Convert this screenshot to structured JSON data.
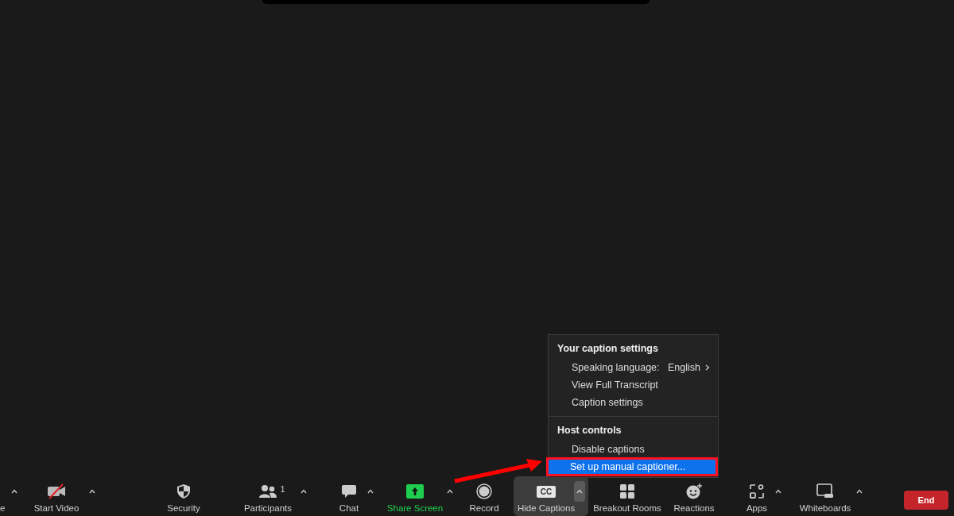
{
  "toolbar": {
    "items": [
      {
        "kind": "mic",
        "label": "e",
        "menu_caret": true,
        "selected": false
      },
      {
        "kind": "video",
        "label": "Start Video",
        "menu_caret": true,
        "selected": false
      },
      {
        "kind": "security",
        "label": "Security",
        "menu_caret": false,
        "selected": false
      },
      {
        "kind": "participants",
        "label": "Participants",
        "count": "1",
        "menu_caret": true,
        "selected": false
      },
      {
        "kind": "chat",
        "label": "Chat",
        "menu_caret": true,
        "selected": false
      },
      {
        "kind": "share",
        "label": "Share Screen",
        "menu_caret": true,
        "selected": false
      },
      {
        "kind": "record",
        "label": "Record",
        "menu_caret": false,
        "selected": false
      },
      {
        "kind": "captions",
        "label": "Hide Captions",
        "icon_text": "CC",
        "menu_caret": true,
        "selected": true
      },
      {
        "kind": "breakout",
        "label": "Breakout Rooms",
        "menu_caret": false,
        "selected": false
      },
      {
        "kind": "reactions",
        "label": "Reactions",
        "menu_caret": false,
        "selected": false
      },
      {
        "kind": "apps",
        "label": "Apps",
        "menu_caret": true,
        "selected": false
      },
      {
        "kind": "whiteboards",
        "label": "Whiteboards",
        "menu_caret": true,
        "selected": false
      }
    ],
    "end_button": "End"
  },
  "caption_menu": {
    "sections": [
      {
        "heading": "Your caption settings",
        "items": [
          {
            "label": "Speaking language:",
            "value": "English",
            "submenu": true,
            "selected": false
          },
          {
            "label": "View Full Transcript",
            "submenu": false,
            "selected": false
          },
          {
            "label": "Caption settings",
            "submenu": false,
            "selected": false
          }
        ]
      },
      {
        "heading": "Host controls",
        "items": [
          {
            "label": "Disable captions",
            "submenu": false,
            "selected": false
          },
          {
            "label": "Set up manual captioner...",
            "submenu": false,
            "selected": true
          }
        ]
      }
    ]
  }
}
